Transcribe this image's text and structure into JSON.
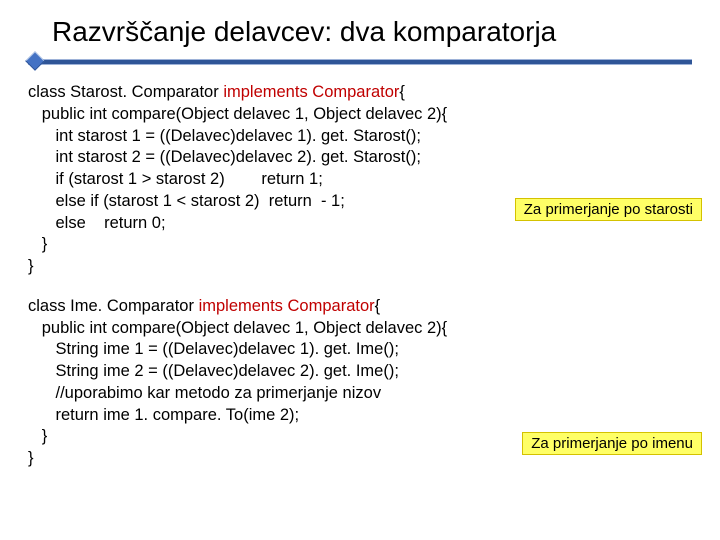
{
  "title": "Razvrščanje delavcev: dva komparatorja",
  "code1": {
    "l1a": "class Starost. Comparator ",
    "l1hl": "implements Comparator",
    "l1b": "{",
    "l2": "   public int compare(Object delavec 1, Object delavec 2){",
    "l3": "      int starost 1 = ((Delavec)delavec 1). get. Starost();",
    "l4": "      int starost 2 = ((Delavec)delavec 2). get. Starost();",
    "l5": "      if (starost 1 > starost 2)        return 1;",
    "l6": "      else if (starost 1 < starost 2)  return  - 1;",
    "l7": "      else    return 0;",
    "l8": "   }",
    "l9": "}"
  },
  "code2": {
    "l1a": "class Ime. Comparator ",
    "l1hl": "implements Comparator",
    "l1b": "{",
    "l2": "   public int compare(Object delavec 1, Object delavec 2){",
    "l3": "      String ime 1 = ((Delavec)delavec 1). get. Ime();",
    "l4": "      String ime 2 = ((Delavec)delavec 2). get. Ime();",
    "l5": "      //uporabimo kar metodo za primerjanje nizov",
    "l6": "      return ime 1. compare. To(ime 2);",
    "l7": "   }",
    "l8": "}"
  },
  "callouts": {
    "starost": "Za primerjanje po starosti",
    "ime": "Za primerjanje po  imenu"
  }
}
